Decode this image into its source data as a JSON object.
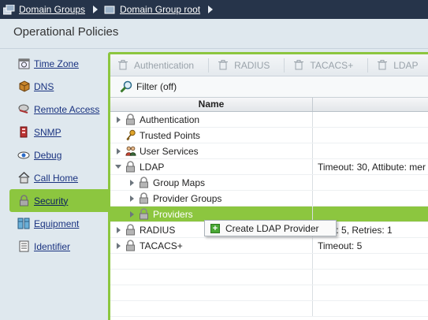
{
  "breadcrumb": {
    "items": [
      {
        "label": "Domain Groups",
        "icon": "domain-groups-icon"
      },
      {
        "label": "Domain Group root",
        "icon": "domain-group-icon"
      }
    ]
  },
  "header": {
    "title": "Operational Policies"
  },
  "sidebar": {
    "items": [
      {
        "label": "Time Zone",
        "icon": "clock-icon"
      },
      {
        "label": "DNS",
        "icon": "dns-icon"
      },
      {
        "label": "Remote Access",
        "icon": "remote-access-icon"
      },
      {
        "label": "SNMP",
        "icon": "snmp-icon"
      },
      {
        "label": "Debug",
        "icon": "debug-icon"
      },
      {
        "label": "Call Home",
        "icon": "call-home-icon"
      },
      {
        "label": "Security",
        "icon": "lock-icon",
        "active": true
      },
      {
        "label": "Equipment",
        "icon": "equipment-icon"
      },
      {
        "label": "Identifier",
        "icon": "identifier-icon"
      }
    ]
  },
  "toolbar": {
    "buttons": [
      "Authentication",
      "RADIUS",
      "TACACS+",
      "LDAP"
    ]
  },
  "filter": {
    "label": "Filter (off)"
  },
  "grid": {
    "column_name": "Name",
    "rows": [
      {
        "name": "Authentication",
        "value": "",
        "indent": 0,
        "toggle": "right",
        "icon": "lock-icon"
      },
      {
        "name": "Trusted Points",
        "value": "",
        "indent": 0,
        "toggle": "none",
        "icon": "key-icon"
      },
      {
        "name": "User Services",
        "value": "",
        "indent": 0,
        "toggle": "right",
        "icon": "users-icon"
      },
      {
        "name": "LDAP",
        "value": "Timeout: 30, Attibute: mer",
        "indent": 0,
        "toggle": "down",
        "icon": "lock-icon"
      },
      {
        "name": "Group Maps",
        "value": "",
        "indent": 1,
        "toggle": "right",
        "icon": "lock-icon"
      },
      {
        "name": "Provider Groups",
        "value": "",
        "indent": 1,
        "toggle": "right",
        "icon": "lock-icon"
      },
      {
        "name": "Providers",
        "value": "",
        "indent": 1,
        "toggle": "right",
        "icon": "lock-icon",
        "selected": true
      },
      {
        "name": "RADIUS",
        "value": "eout: 5, Retries: 1",
        "indent": 0,
        "toggle": "right",
        "icon": "lock-icon"
      },
      {
        "name": "TACACS+",
        "value": "Timeout: 5",
        "indent": 0,
        "toggle": "right",
        "icon": "lock-icon"
      },
      {
        "name": "",
        "value": "",
        "indent": 0,
        "toggle": "none",
        "icon": ""
      },
      {
        "name": "",
        "value": "",
        "indent": 0,
        "toggle": "none",
        "icon": ""
      },
      {
        "name": "",
        "value": "",
        "indent": 0,
        "toggle": "none",
        "icon": ""
      },
      {
        "name": "",
        "value": "",
        "indent": 0,
        "toggle": "none",
        "icon": ""
      }
    ]
  },
  "context_menu": {
    "item": "Create LDAP Provider",
    "icon": "plus-icon"
  },
  "colors": {
    "accent": "#8cc63f",
    "nav": "#26344a",
    "link": "#1a3380"
  }
}
